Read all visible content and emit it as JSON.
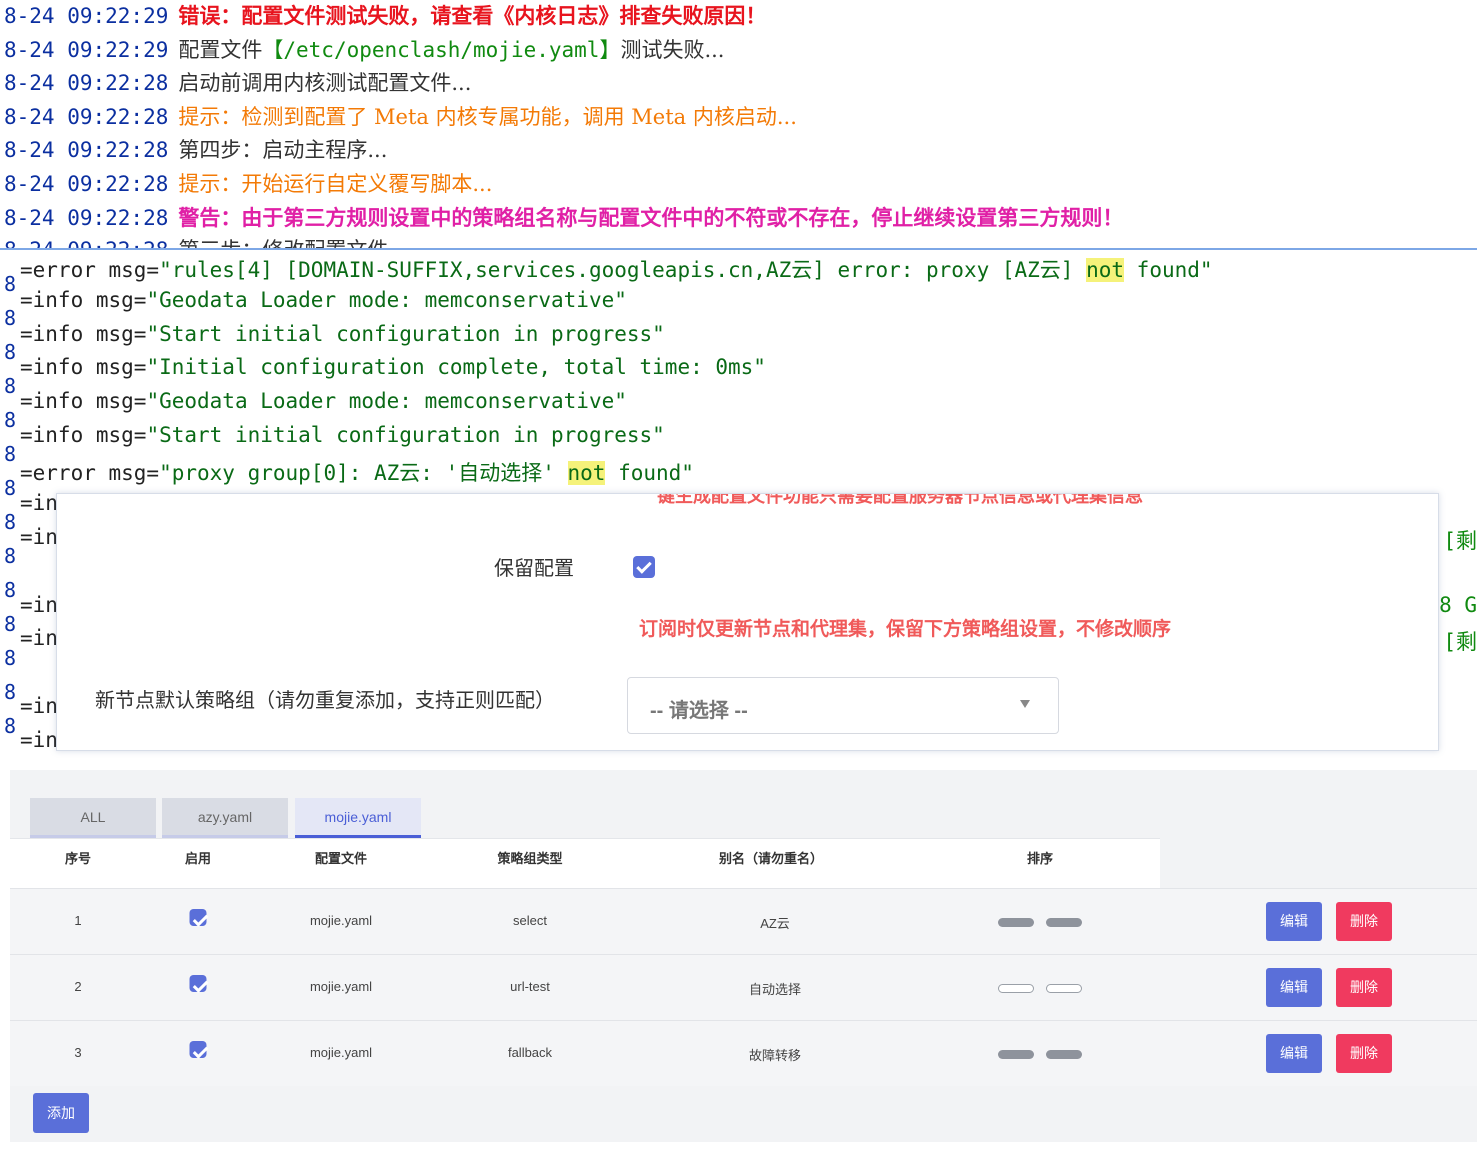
{
  "top_log": [
    {
      "ts": "8-24 09:22:29",
      "msg": "错误：配置文件测试失败，请查看《内核日志》排查失败原因！",
      "style": "red"
    },
    {
      "ts": "8-24 09:22:29",
      "pre": "配置文件",
      "path": "【/etc/openclash/mojie.yaml】",
      "post": "测试失败...",
      "style": "path"
    },
    {
      "ts": "8-24 09:22:28",
      "msg": "启动前调用内核测试配置文件...",
      "style": "gray"
    },
    {
      "ts": "8-24 09:22:28",
      "msg": "提示：检测到配置了 Meta 内核专属功能，调用 Meta 内核启动...",
      "style": "orange"
    },
    {
      "ts": "8-24 09:22:28",
      "msg": "第四步：启动主程序...",
      "style": "gray"
    },
    {
      "ts": "8-24 09:22:28",
      "msg": "提示：开始运行自定义覆写脚本...",
      "style": "orange"
    },
    {
      "ts": "8-24 09:22:28",
      "msg": "警告：由于第三方规则设置中的策略组名称与配置文件中的不符或不存在，停止继续设置第三方规则！",
      "style": "magenta"
    },
    {
      "ts": "8-24 09:22:28",
      "msg": "第三步：修改配置文件...",
      "style": "gray"
    }
  ],
  "kernel_log": [
    {
      "prefix": "=error msg=",
      "q_pre": "\"rules[4] [DOMAIN-SUFFIX,services.googleapis.cn,AZ云] error: proxy [AZ云] ",
      "hl": "not",
      "q_post": " found\""
    },
    {
      "prefix": "=info msg=",
      "q_pre": "\"Geodata Loader mode: memconservative\"",
      "hl": "",
      "q_post": ""
    },
    {
      "prefix": "=info msg=",
      "q_pre": "\"Start initial configuration in progress\"",
      "hl": "",
      "q_post": ""
    },
    {
      "prefix": "=info msg=",
      "q_pre": "\"Initial configuration complete, total time: 0ms\"",
      "hl": "",
      "q_post": ""
    },
    {
      "prefix": "=info msg=",
      "q_pre": "\"Geodata Loader mode: memconservative\"",
      "hl": "",
      "q_post": ""
    },
    {
      "prefix": "=info msg=",
      "q_pre": "\"Start initial configuration in progress\"",
      "hl": "",
      "q_post": ""
    },
    {
      "prefix": "=error msg=",
      "q_pre": "\"proxy group[0]: AZ云: '自动选择' ",
      "hl": "not",
      "q_post": " found\""
    },
    {
      "prefix": "=in"
    },
    {
      "prefix": "=in"
    },
    {
      "prefix": "=in"
    },
    {
      "prefix": "=in"
    },
    {
      "prefix": "=in"
    },
    {
      "prefix": "=in"
    }
  ],
  "kernel_gutter": "8",
  "side_fragments": [
    "[剩",
    "8 G",
    "[剩"
  ],
  "modal": {
    "cut_text": "键生成配置文件功能只需要配置服务器节点信息或代理集信息",
    "keep_label": "保留配置",
    "keep_checked": true,
    "hint": "订阅时仅更新节点和代理集，保留下方策略组设置，不修改顺序",
    "group_label": "新节点默认策略组（请勿重复添加，支持正则匹配）",
    "select_placeholder": "-- 请选择 --"
  },
  "tabs": [
    "ALL",
    "azy.yaml",
    "mojie.yaml"
  ],
  "active_tab": "mojie.yaml",
  "table": {
    "headers": [
      "序号",
      "启用",
      "配置文件",
      "策略组类型",
      "别名（请勿重名）",
      "排序"
    ],
    "rows": [
      {
        "index": "1",
        "enabled": true,
        "file": "mojie.yaml",
        "type": "select",
        "alias": "AZ云",
        "sort_style": "dark"
      },
      {
        "index": "2",
        "enabled": true,
        "file": "mojie.yaml",
        "type": "url-test",
        "alias": "自动选择",
        "sort_style": "light"
      },
      {
        "index": "3",
        "enabled": true,
        "file": "mojie.yaml",
        "type": "fallback",
        "alias": "故障转移",
        "sort_style": "dark"
      }
    ],
    "edit_label": "编辑",
    "delete_label": "删除",
    "add_label": "添加"
  },
  "colors": {
    "accent": "#5a6fd9",
    "danger": "#f03a5f",
    "error_text": "#e8141e",
    "warn_text": "#f37a06",
    "alert_text": "#e020a6"
  }
}
